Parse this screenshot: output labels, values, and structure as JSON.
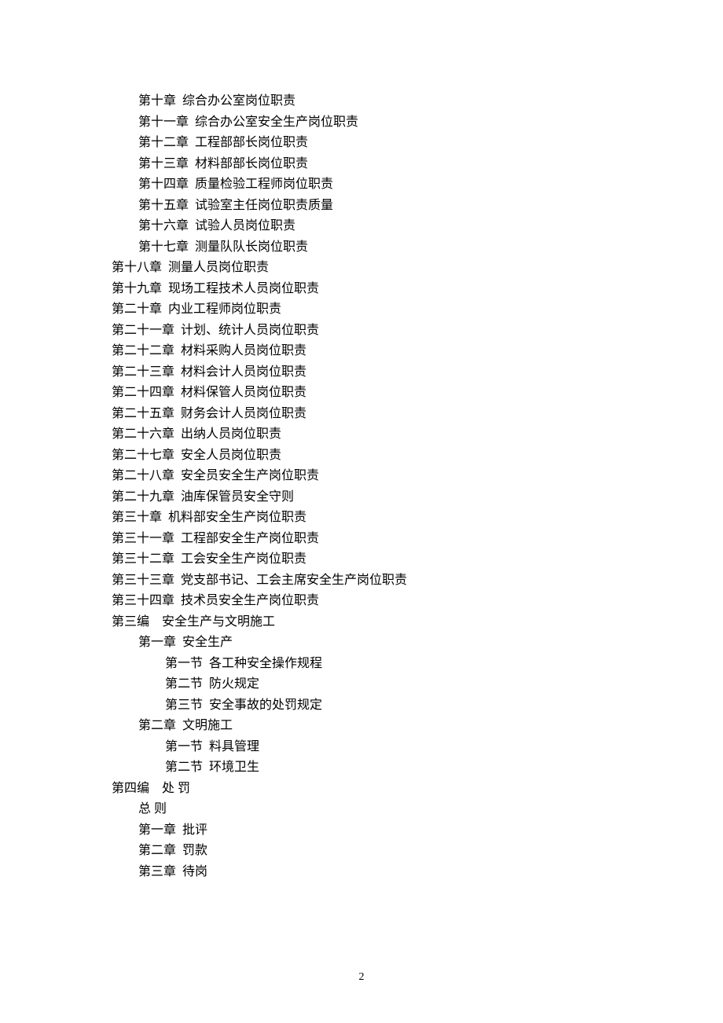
{
  "lines": [
    {
      "indent": 1,
      "text": "第十章  综合办公室岗位职责"
    },
    {
      "indent": 1,
      "text": "第十一章  综合办公室安全生产岗位职责"
    },
    {
      "indent": 1,
      "text": "第十二章  工程部部长岗位职责"
    },
    {
      "indent": 1,
      "text": "第十三章  材料部部长岗位职责"
    },
    {
      "indent": 1,
      "text": "第十四章  质量检验工程师岗位职责"
    },
    {
      "indent": 1,
      "text": "第十五章  试验室主任岗位职责质量"
    },
    {
      "indent": 1,
      "text": "第十六章  试验人员岗位职责"
    },
    {
      "indent": 1,
      "text": "第十七章  测量队队长岗位职责"
    },
    {
      "indent": 0,
      "text": "第十八章  测量人员岗位职责"
    },
    {
      "indent": 0,
      "text": "第十九章  现场工程技术人员岗位职责"
    },
    {
      "indent": 0,
      "text": "第二十章  内业工程师岗位职责"
    },
    {
      "indent": 0,
      "text": "第二十一章  计划、统计人员岗位职责"
    },
    {
      "indent": 0,
      "text": "第二十二章  材料采购人员岗位职责"
    },
    {
      "indent": 0,
      "text": "第二十三章  材料会计人员岗位职责"
    },
    {
      "indent": 0,
      "text": "第二十四章  材料保管人员岗位职责"
    },
    {
      "indent": 0,
      "text": "第二十五章  财务会计人员岗位职责"
    },
    {
      "indent": 0,
      "text": "第二十六章  出纳人员岗位职责"
    },
    {
      "indent": 0,
      "text": "第二十七章  安全人员岗位职责"
    },
    {
      "indent": 0,
      "text": "第二十八章  安全员安全生产岗位职责"
    },
    {
      "indent": 0,
      "text": "第二十九章  油库保管员安全守则"
    },
    {
      "indent": 0,
      "text": "第三十章  机料部安全生产岗位职责"
    },
    {
      "indent": 0,
      "text": "第三十一章  工程部安全生产岗位职责"
    },
    {
      "indent": 0,
      "text": "第三十二章  工会安全生产岗位职责"
    },
    {
      "indent": 0,
      "text": "第三十三章  党支部书记、工会主席安全生产岗位职责"
    },
    {
      "indent": 0,
      "text": "第三十四章  技术员安全生产岗位职责"
    },
    {
      "indent": 0,
      "text": "第三编    安全生产与文明施工"
    },
    {
      "indent": 2,
      "text": "第一章  安全生产"
    },
    {
      "indent": 3,
      "text": "第一节  各工种安全操作规程"
    },
    {
      "indent": 3,
      "text": "第二节  防火规定"
    },
    {
      "indent": 3,
      "text": "第三节  安全事故的处罚规定"
    },
    {
      "indent": 2,
      "text": "第二章  文明施工"
    },
    {
      "indent": 3,
      "text": "第一节  料具管理"
    },
    {
      "indent": 3,
      "text": "第二节  环境卫生"
    },
    {
      "indent": 0,
      "text": "第四编    处 罚"
    },
    {
      "indent": 2,
      "text": "总 则"
    },
    {
      "indent": 2,
      "text": "第一章  批评"
    },
    {
      "indent": 2,
      "text": "第二章  罚款"
    },
    {
      "indent": 2,
      "text": "第三章  待岗"
    }
  ],
  "page_number": "2"
}
